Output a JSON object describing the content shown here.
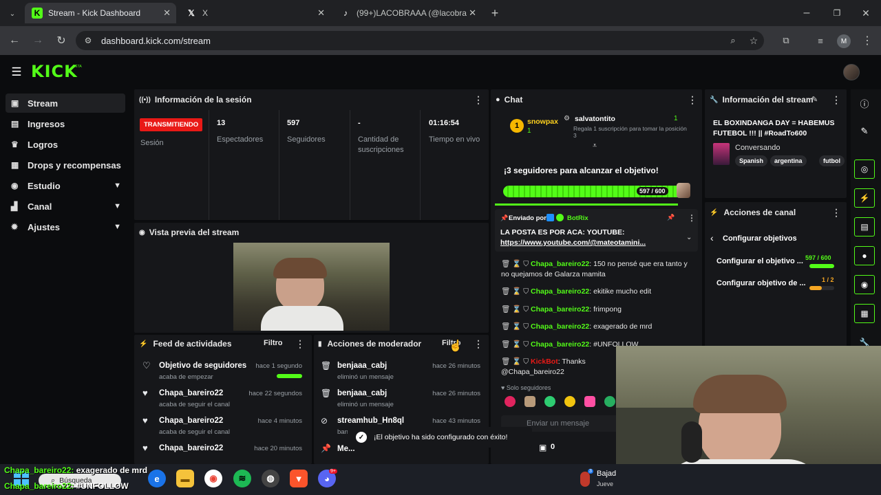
{
  "browser": {
    "tabs": [
      {
        "title": "Stream - Kick Dashboard",
        "icon": "kick-icon"
      },
      {
        "title": "X",
        "icon": "x-icon"
      },
      {
        "title": "(99+)LACOBRAAA (@lacobraaa",
        "icon": "tiktok-icon"
      }
    ],
    "url": "dashboard.kick.com/stream",
    "profile_initial": "M"
  },
  "app": {
    "logo": "KICK",
    "logo_badge": "BETA"
  },
  "sidebar": {
    "items": [
      {
        "label": "Stream",
        "icon": "stream-icon",
        "active": true
      },
      {
        "label": "Ingresos",
        "icon": "revenue-icon"
      },
      {
        "label": "Logros",
        "icon": "trophy-icon"
      },
      {
        "label": "Drops y recompensas",
        "icon": "gift-icon"
      },
      {
        "label": "Estudio",
        "icon": "studio-icon",
        "expandable": true
      },
      {
        "label": "Canal",
        "icon": "channel-icon",
        "expandable": true
      },
      {
        "label": "Ajustes",
        "icon": "settings-icon",
        "expandable": true
      }
    ]
  },
  "session": {
    "title": "Información de la sesión",
    "status": "TRANSMITIENDO",
    "status_label": "Sesión",
    "stats": [
      {
        "value": "13",
        "label": "Espectadores"
      },
      {
        "value": "597",
        "label": "Seguidores"
      },
      {
        "value": "-",
        "label": "Cantidad de suscripciones"
      },
      {
        "value": "01:16:54",
        "label": "Tiempo en vivo"
      }
    ]
  },
  "preview": {
    "title": "Vista previa del stream"
  },
  "activity": {
    "title": "Feed de actividades",
    "filter": "Filtro",
    "items": [
      {
        "title": "Objetivo de seguidores",
        "sub": "acaba de empezar",
        "time": "hace 1 segundo",
        "progress": 1.0
      },
      {
        "title": "Chapa_bareiro22",
        "sub": "acaba de seguir el canal",
        "time": "hace 22 segundos"
      },
      {
        "title": "Chapa_bareiro22",
        "sub": "acaba de seguir el canal",
        "time": "hace 4 minutos"
      },
      {
        "title": "Chapa_bareiro22",
        "sub": "",
        "time": "hace 20 minutos"
      }
    ]
  },
  "moderator": {
    "title": "Acciones de moderador",
    "filter": "Filtro",
    "items": [
      {
        "title": "benjaaa_cabj",
        "sub": "eliminó un mensaje",
        "time": "hace 26 minutos"
      },
      {
        "title": "benjaaa_cabj",
        "sub": "eliminó un mensaje",
        "time": "hace 26 minutos"
      },
      {
        "title": "streamhub_Hn8ql",
        "sub": "ban",
        "time": "hace 43 minutos"
      },
      {
        "title": "Me...",
        "sub": "",
        "time": ""
      }
    ]
  },
  "chat": {
    "title": "Chat",
    "gift_user": "snowpax",
    "gift_rank": "1",
    "gift_count": "1",
    "gift_target": "salvatontito",
    "gift_target_count": "1",
    "gift_text": "Regala 1 suscripción para tomar la posición 3",
    "goal_text": "¡3 seguidores para alcanzar el objetivo!",
    "goal_current": 597,
    "goal_target": 600,
    "goal_label": "597 / 600",
    "pinned_by_label": "Enviado por",
    "pinned_by": "BotRix",
    "pinned_text": "LA POSTA ES POR ACA: YOUTUBE:",
    "pinned_link": "https://www.youtube.com/@mateotamini...",
    "messages": [
      {
        "user": "Chapa_bareiro22",
        "text": ": 150 no pensé que era tanto y no quejamos de Galarza mamita"
      },
      {
        "user": "Chapa_bareiro22",
        "text": ": ekitike mucho edit"
      },
      {
        "user": "Chapa_bareiro22",
        "text": ": frimpong"
      },
      {
        "user": "Chapa_bareiro22",
        "text": ": exagerado de mrd"
      },
      {
        "user": "Chapa_bareiro22",
        "text": ": #UNFOLLOW"
      },
      {
        "user": "KickBot",
        "text": ": Thanks @Chapa_bareiro22"
      }
    ],
    "followers_only": "Solo seguidores",
    "placeholder": "Enviar un mensaje",
    "points": "0"
  },
  "stream_info": {
    "title": "Información del stream",
    "stream_title": "EL BOXINDANGA DAY = HABEMUS FUTEBOL !!! || #RoadTo600",
    "category": "Conversando",
    "tags": [
      "Spanish",
      "argentina",
      "futbol"
    ]
  },
  "channel_actions": {
    "title": "Acciones de canal",
    "back_label": "Configurar objetivos",
    "goals": [
      {
        "label": "Configurar el objetivo ...",
        "value": "597 / 600",
        "fraction": 0.995,
        "color": "#53fc18"
      },
      {
        "label": "Configurar objetivo de ...",
        "value": "1 / 2",
        "fraction": 0.5,
        "color": "#f5a623"
      }
    ]
  },
  "toast": {
    "text": "¡El objetivo ha sido configurado con éxito!"
  },
  "overlay_chat": [
    {
      "user": "Chapa_bareiro22",
      "text": "exagerado de mrd"
    },
    {
      "user": "Chapa_bareiro22",
      "text": "#UNFOLLOW"
    }
  ],
  "taskbar": {
    "search": "Búsqueda",
    "weather_label": "Bajad",
    "weather_sub": "Jueve",
    "weather_badge": "3",
    "discord_badge": "9+"
  }
}
